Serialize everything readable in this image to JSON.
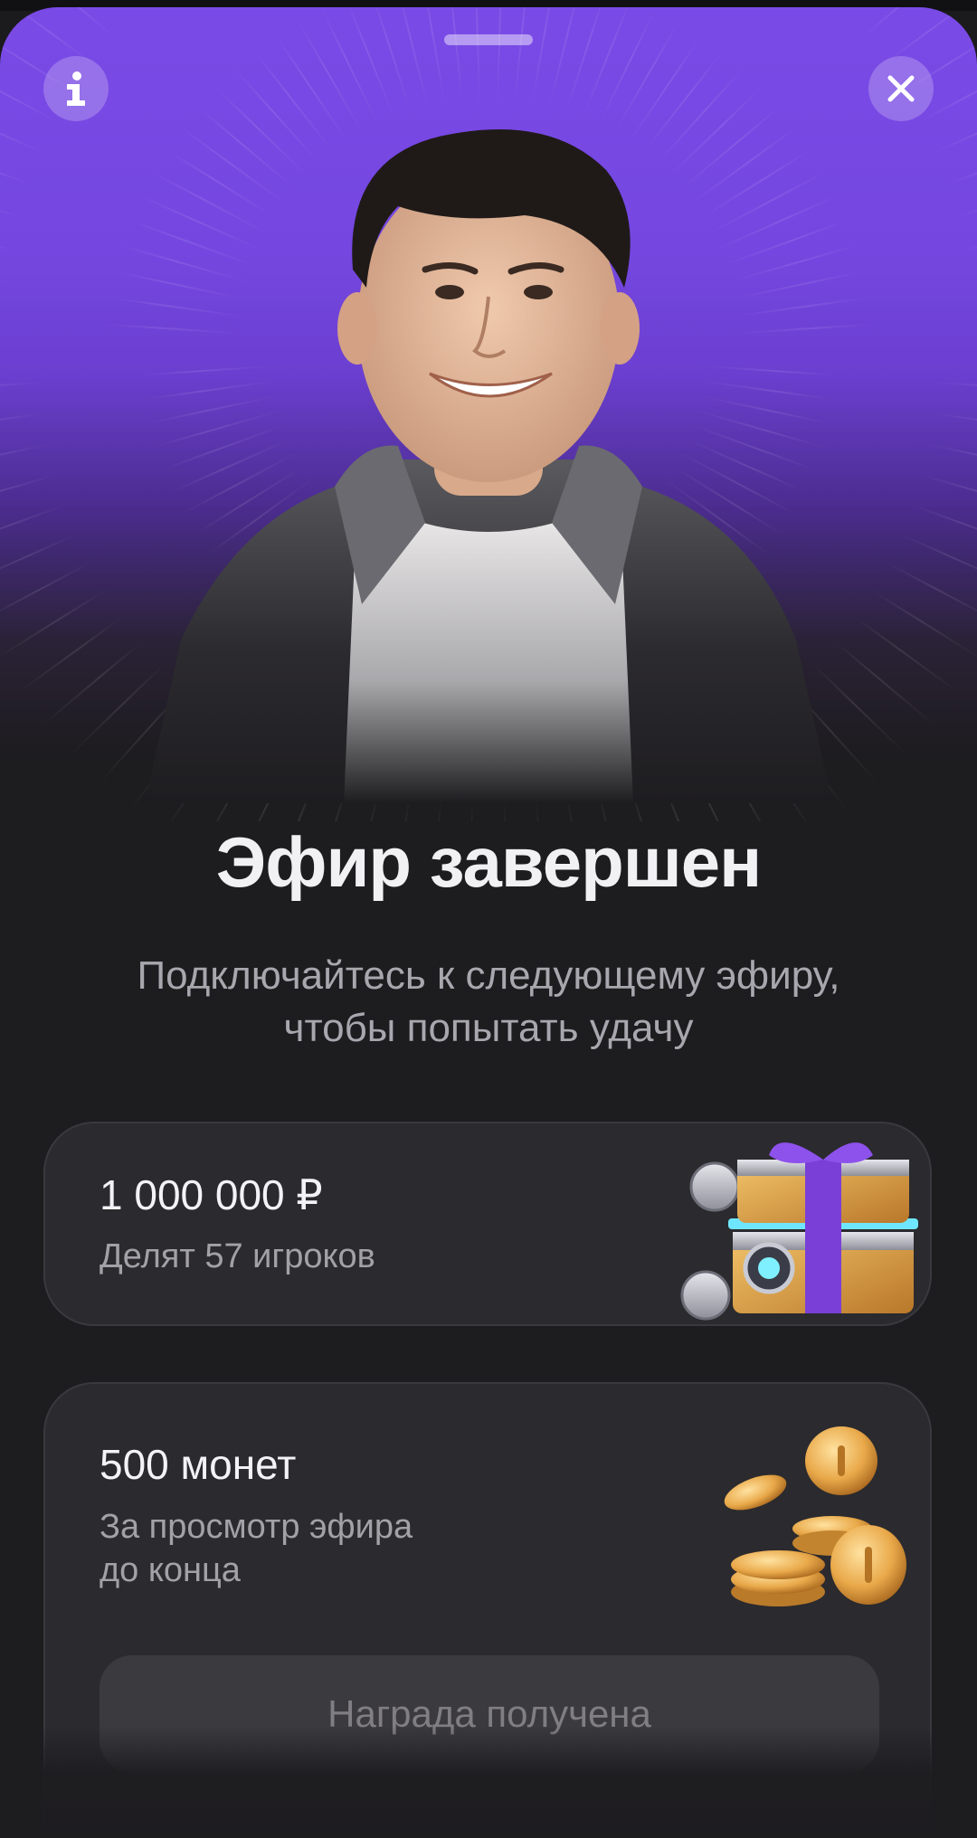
{
  "header": {
    "info_icon": "info-icon",
    "close_icon": "close-icon"
  },
  "main": {
    "title": "Эфир завершен",
    "subtitle_line1": "Подключайтесь к следующему эфиру,",
    "subtitle_line2": "чтобы попытать удачу"
  },
  "prize_card": {
    "amount": "1 000 000 ₽",
    "description": "Делят 57 игроков",
    "image_icon": "gift-chest-icon"
  },
  "coins_card": {
    "amount": "500 монет",
    "description_line1": "За просмотр эфира",
    "description_line2": "до конца",
    "image_icon": "gold-coins-icon",
    "button_label": "Награда получена"
  },
  "colors": {
    "hero_purple": "#7a4ae6",
    "background": "#1d1c1f",
    "card": "#2b2a2e"
  }
}
